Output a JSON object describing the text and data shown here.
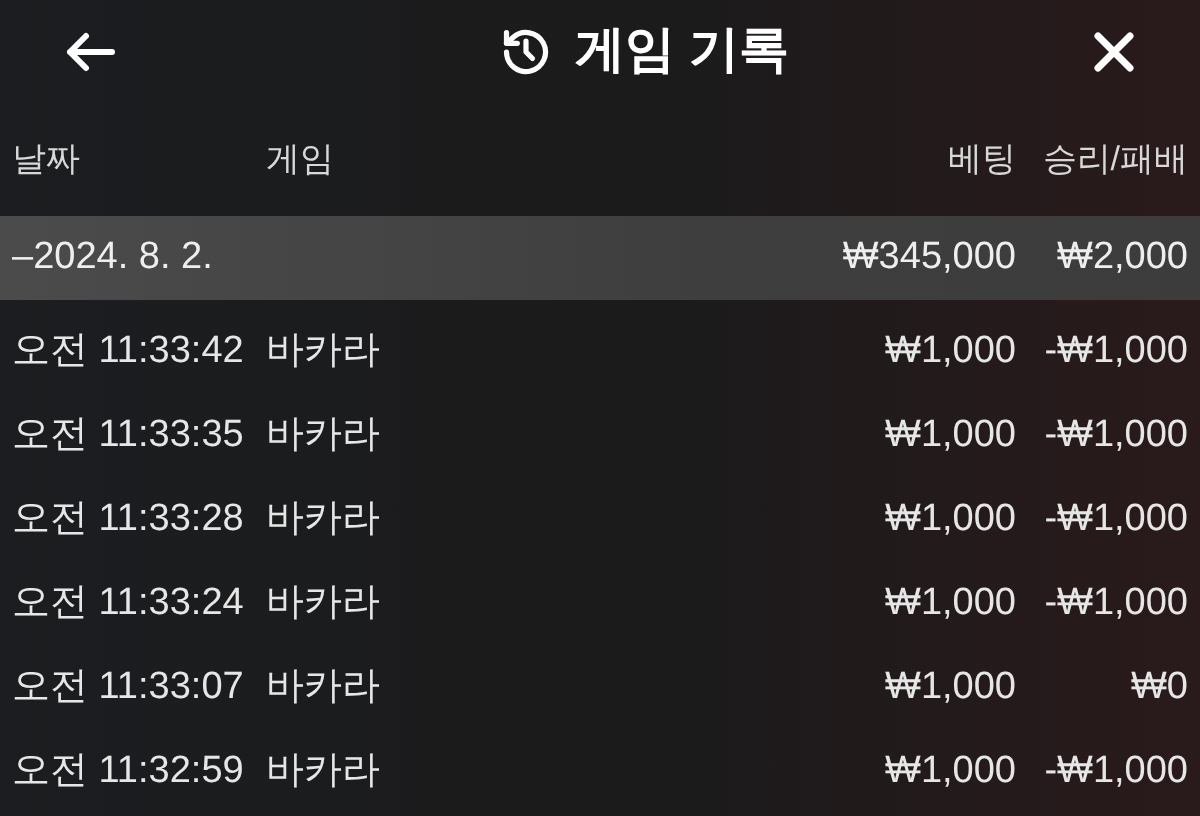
{
  "header": {
    "title": "게임 기록"
  },
  "columns": [
    "날짜",
    "게임",
    "베팅",
    "승리/패배"
  ],
  "group": {
    "date": "–2024. 8. 2.",
    "bet": "₩345,000",
    "result": "₩2,000"
  },
  "rows": [
    {
      "time": "오전 11:33:42",
      "game": "바카라",
      "bet": "₩1,000",
      "result": "-₩1,000"
    },
    {
      "time": "오전 11:33:35",
      "game": "바카라",
      "bet": "₩1,000",
      "result": "-₩1,000"
    },
    {
      "time": "오전 11:33:28",
      "game": "바카라",
      "bet": "₩1,000",
      "result": "-₩1,000"
    },
    {
      "time": "오전 11:33:24",
      "game": "바카라",
      "bet": "₩1,000",
      "result": "-₩1,000"
    },
    {
      "time": "오전 11:33:07",
      "game": "바카라",
      "bet": "₩1,000",
      "result": "₩0"
    },
    {
      "time": "오전 11:32:59",
      "game": "바카라",
      "bet": "₩1,000",
      "result": "-₩1,000"
    }
  ]
}
